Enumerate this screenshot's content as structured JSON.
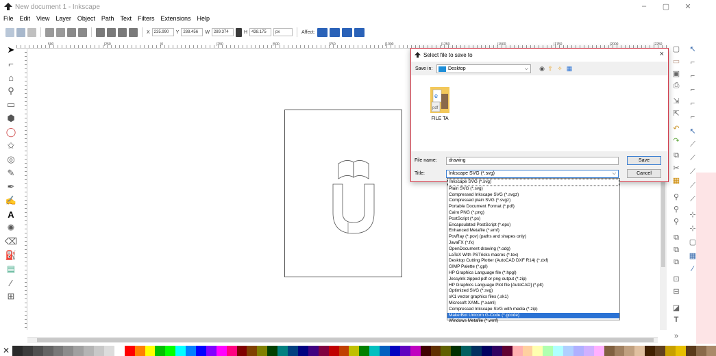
{
  "window": {
    "title": "New document 1 - Inkscape",
    "controls": [
      "–",
      "▢",
      "✕"
    ]
  },
  "menu": [
    "File",
    "Edit",
    "View",
    "Layer",
    "Object",
    "Path",
    "Text",
    "Filters",
    "Extensions",
    "Help"
  ],
  "toolbar": {
    "x_label": "X",
    "x_value": "235.990",
    "y_label": "Y",
    "y_value": "288.456",
    "w_label": "W",
    "w_value": "289.374",
    "h_label": "H",
    "h_value": "438.175",
    "unit": "px",
    "affect_label": "Affect:"
  },
  "ruler_ticks": [
    "500",
    "|250",
    "|0",
    "|250",
    "|500",
    "|750",
    "|1000",
    "|1250",
    "|1500",
    "|1750",
    "|2000",
    "|2250"
  ],
  "dialog": {
    "title": "Select file to save to",
    "close": "×",
    "save_in_label": "Save in:",
    "save_in_value": "Desktop",
    "file_item": "FILE TA",
    "file_name_label": "File name:",
    "file_name_value": "drawing",
    "type_label": "Title:",
    "type_value": "Inkscape SVG (*.svg)",
    "save_button": "Save",
    "cancel_button": "Cancel"
  },
  "dropdown_options": [
    "Inkscape SVG (*.svg)",
    "Plain SVG (*.svg)",
    "Compressed Inkscape SVG (*.svgz)",
    "Compressed plain SVG (*.svgz)",
    "Portable Document Format (*.pdf)",
    "Cairo PNG (*.png)",
    "PostScript (*.ps)",
    "Encapsulated PostScript (*.eps)",
    "Enhanced Metafile (*.emf)",
    "PovRay (*.pov) (paths and shapes only)",
    "JavaFX (*.fx)",
    "OpenDocument drawing (*.odg)",
    "LaTeX With PSTricks macros (*.tex)",
    "Desktop Cutting Plotter (AutoCAD DXF R14) (*.dxf)",
    "GIMP Palette (*.gpl)",
    "HP Graphics Language file (*.hpgl)",
    "Jessylnk zipped pdf or png output (*.zip)",
    "HP Graphics Language Plot file [AutoCAD] (*.plt)",
    "Optimized SVG (*.svg)",
    "sK1 vector graphics files (.sk1)",
    "Microsoft XAML (*.xaml)",
    "Compressed Inkscape SVG with media (*.zip)",
    "MakerBot Unicorn G-Code (*.gcode)",
    "Windows Metafile (*.wmf)"
  ],
  "dropdown_highlighted": "MakerBot Unicorn G-Code (*.gcode)",
  "palette": [
    "#2b2b2b",
    "#3c3c3c",
    "#505050",
    "#646464",
    "#787878",
    "#8c8c8c",
    "#a0a0a0",
    "#b4b4b4",
    "#c8c8c8",
    "#dcdcdc",
    "#ffffff",
    "#ff0000",
    "#ff8000",
    "#ffff00",
    "#00c000",
    "#00ff00",
    "#00ffff",
    "#0080ff",
    "#0000ff",
    "#8000ff",
    "#ff00ff",
    "#ff0080",
    "#800000",
    "#804000",
    "#808000",
    "#004000",
    "#008080",
    "#004080",
    "#000080",
    "#400080",
    "#800040",
    "#c00000",
    "#c04000",
    "#c0c000",
    "#008000",
    "#00c0c0",
    "#0060c0",
    "#0000c0",
    "#6000c0",
    "#c000c0",
    "#400000",
    "#603000",
    "#606000",
    "#003000",
    "#006060",
    "#003060",
    "#000060",
    "#300060",
    "#600030",
    "#ffb0b0",
    "#ffd0a0",
    "#ffffb0",
    "#b0ffb0",
    "#b0ffff",
    "#b0d0ff",
    "#b0b0ff",
    "#d0b0ff",
    "#ffb0ff",
    "#806040",
    "#a08060",
    "#c0a080",
    "#e0c0a0",
    "#402000",
    "#604020",
    "#c8a000",
    "#e8c000",
    "#5a3a1a",
    "#8a6a4a",
    "#aa8a6a"
  ]
}
